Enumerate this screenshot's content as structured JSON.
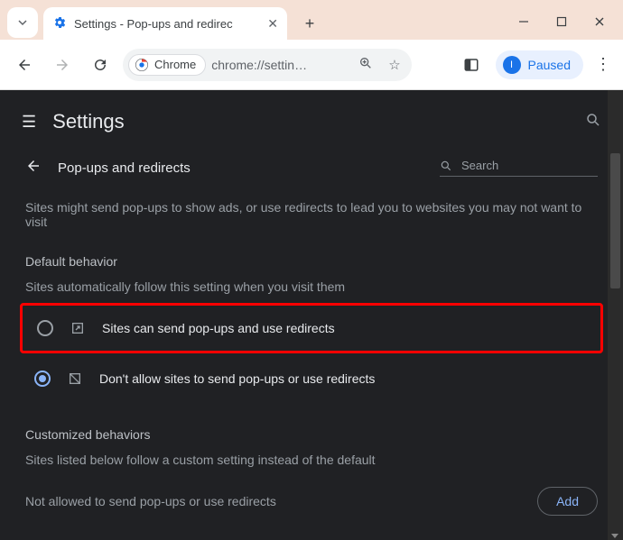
{
  "tab": {
    "title": "Settings - Pop-ups and redirec"
  },
  "omnibox": {
    "chip_label": "Chrome",
    "url": "chrome://settin…"
  },
  "profile": {
    "status": "Paused",
    "initial": "I"
  },
  "header": {
    "title": "Settings"
  },
  "page": {
    "title": "Pop-ups and redirects",
    "search_placeholder": "Search",
    "description": "Sites might send pop-ups to show ads, or use redirects to lead you to websites you may not want to visit",
    "default_section_title": "Default behavior",
    "default_section_sub": "Sites automatically follow this setting when you visit them",
    "option_allow": "Sites can send pop-ups and use redirects",
    "option_block": "Don't allow sites to send pop-ups or use redirects",
    "custom_section_title": "Customized behaviors",
    "custom_section_sub": "Sites listed below follow a custom setting instead of the default",
    "not_allowed_label": "Not allowed to send pop-ups or use redirects",
    "add_label": "Add"
  }
}
